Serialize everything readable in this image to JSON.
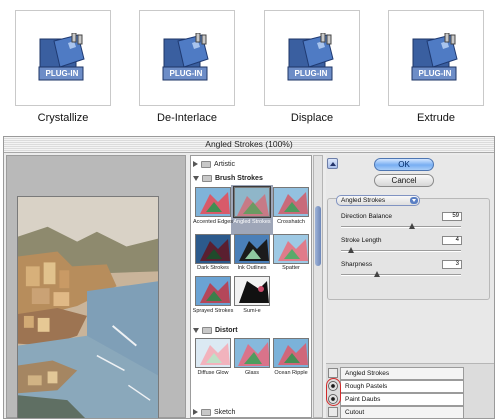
{
  "plugins": [
    {
      "badge": "PLUG-IN",
      "label": "Crystallize"
    },
    {
      "badge": "PLUG-IN",
      "label": "De-Interlace"
    },
    {
      "badge": "PLUG-IN",
      "label": "Displace"
    },
    {
      "badge": "PLUG-IN",
      "label": "Extrude"
    }
  ],
  "dialog": {
    "title": "Angled Strokes (100%)",
    "categories": {
      "artistic": "Artistic",
      "brush_strokes": "Brush Strokes",
      "distort": "Distort",
      "sketch": "Sketch"
    },
    "brush_filters": [
      {
        "label": "Accented Edges"
      },
      {
        "label": "Angled Strokes"
      },
      {
        "label": "Crosshatch"
      },
      {
        "label": "Dark Strokes"
      },
      {
        "label": "Ink Outlines"
      },
      {
        "label": "Spatter"
      },
      {
        "label": "Sprayed Strokes"
      },
      {
        "label": "Sumi-e"
      }
    ],
    "distort_filters": [
      {
        "label": "Diffuse Glow"
      },
      {
        "label": "Glass"
      },
      {
        "label": "Ocean Ripple"
      }
    ],
    "selected_filter": "Angled Strokes",
    "ok_label": "OK",
    "cancel_label": "Cancel",
    "params": [
      {
        "label": "Direction Balance",
        "value": "59",
        "fraction": 0.59
      },
      {
        "label": "Stroke Length",
        "value": "4",
        "fraction": 0.08
      },
      {
        "label": "Sharpness",
        "value": "3",
        "fraction": 0.3
      }
    ],
    "layers": [
      {
        "label": "Angled Strokes",
        "visible": false
      },
      {
        "label": "Rough Pastels",
        "visible": true
      },
      {
        "label": "Paint Daubs",
        "visible": true
      },
      {
        "label": "Cutout",
        "visible": false
      }
    ]
  }
}
